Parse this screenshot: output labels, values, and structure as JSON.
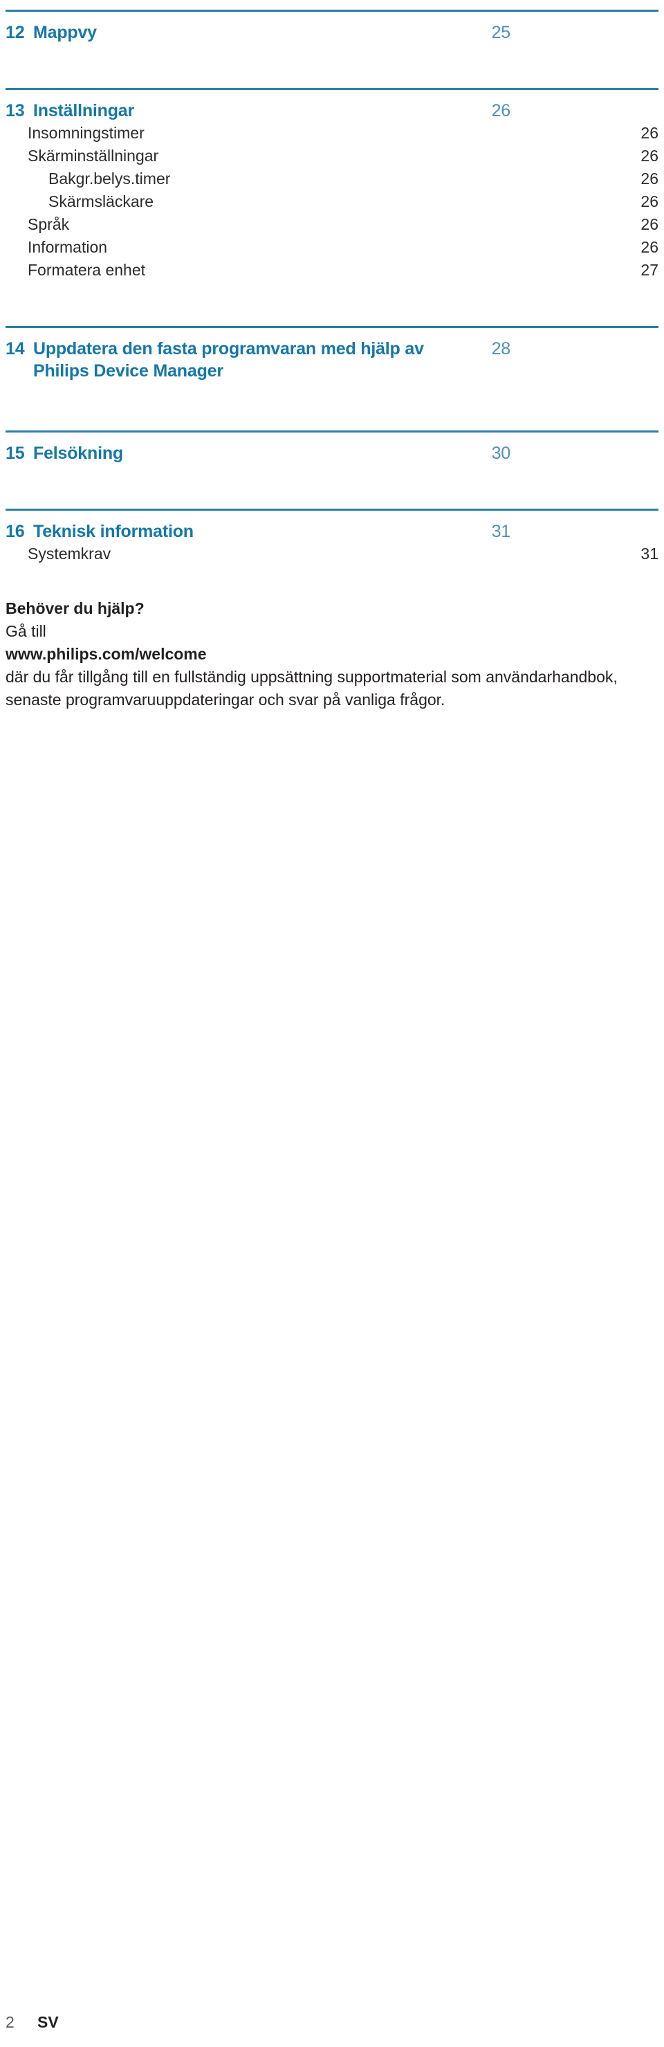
{
  "document": {
    "language_code": "SV",
    "folio": "2"
  },
  "colors": {
    "accent": "#1577a8",
    "rule": "#2a7ea6",
    "chapter_page_number": "#4e90b4",
    "body_text": "#2b2b2b"
  },
  "toc": {
    "chapters": [
      {
        "number": "12",
        "title": "Mappvy",
        "page": "25",
        "entries": []
      },
      {
        "number": "13",
        "title": "Inställningar",
        "page": "26",
        "entries": [
          {
            "label": "Insomningstimer",
            "page": "26",
            "level": 1
          },
          {
            "label": "Skärminställningar",
            "page": "26",
            "level": 1
          },
          {
            "label": "Bakgr.belys.timer",
            "page": "26",
            "level": 2
          },
          {
            "label": "Skärmsläckare",
            "page": "26",
            "level": 2
          },
          {
            "label": "Språk",
            "page": "26",
            "level": 1
          },
          {
            "label": "Information",
            "page": "26",
            "level": 1
          },
          {
            "label": "Formatera enhet",
            "page": "27",
            "level": 1
          }
        ]
      },
      {
        "number": "14",
        "title": "Uppdatera den fasta programvaran med hjälp av Philips Device Manager",
        "page": "28",
        "entries": []
      },
      {
        "number": "15",
        "title": "Felsökning",
        "page": "30",
        "entries": []
      },
      {
        "number": "16",
        "title": "Teknisk information",
        "page": "31",
        "entries": [
          {
            "label": "Systemkrav",
            "page": "31",
            "level": 1
          }
        ]
      }
    ]
  },
  "help": {
    "heading": "Behöver du hjälp?",
    "line_goto": "Gå till",
    "url": "www.philips.com/welcome",
    "body": "där du får tillgång till en fullständig uppsättning supportmaterial som användarhandbok, senaste programvaruuppdateringar och svar på vanliga frågor."
  }
}
